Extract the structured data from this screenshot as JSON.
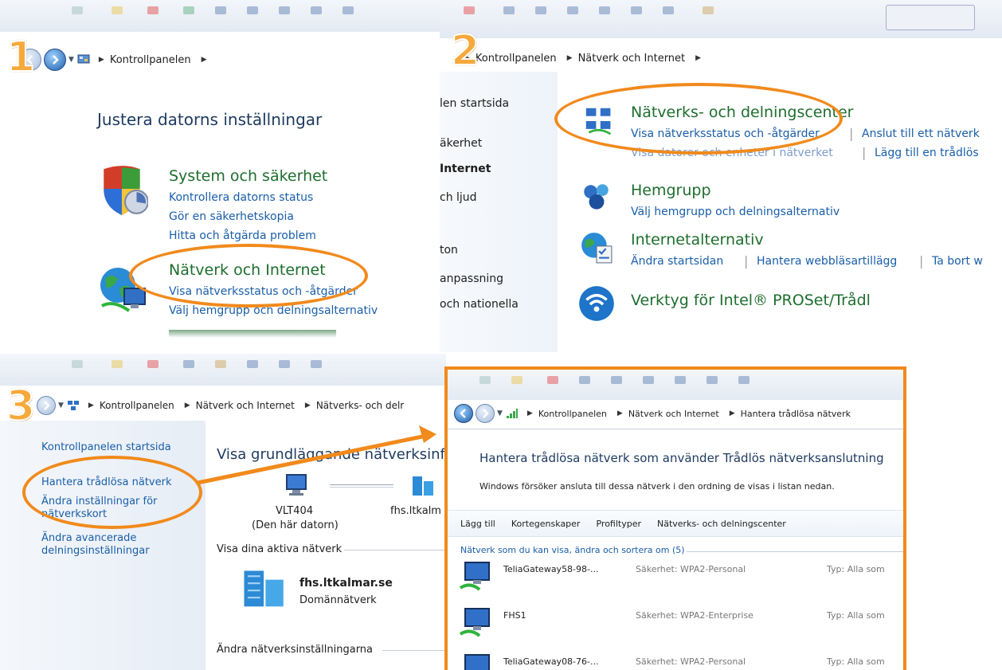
{
  "steps": [
    "1",
    "2",
    "3"
  ],
  "panel1": {
    "breadcrumb": [
      "Kontrollpanelen"
    ],
    "heading": "Justera datorns inställningar",
    "categories": [
      {
        "title": "System och säkerhet",
        "links": [
          "Kontrollera datorns status",
          "Gör en säkerhetskopia",
          "Hitta och åtgärda problem"
        ],
        "icon": "shield-icon"
      },
      {
        "title": "Nätverk och Internet",
        "links": [
          "Visa nätverksstatus och -åtgärder",
          "Välj hemgrupp och delningsalternativ"
        ],
        "icon": "globe-network-icon"
      }
    ]
  },
  "panel2": {
    "breadcrumb": [
      "Kontrollpanelen",
      "Nätverk och Internet"
    ],
    "sidebar": [
      "len startsida",
      "äkerhet",
      "Internet",
      "ch ljud",
      "ton",
      "anpassning",
      "och nationella"
    ],
    "categories": [
      {
        "title": "Nätverks- och delningscenter",
        "links": [
          "Visa nätverksstatus och -åtgärder",
          "Anslut till ett nätverk"
        ],
        "links2": [
          "Visa datorer och enheter i nätverket",
          "Lägg till en trådlös"
        ],
        "icon": "network-center-icon"
      },
      {
        "title": "Hemgrupp",
        "links": [
          "Välj hemgrupp och delningsalternativ"
        ],
        "icon": "homegroup-icon"
      },
      {
        "title": "Internetalternativ",
        "links": [
          "Ändra startsidan",
          "Hantera webbläsartillägg",
          "Ta bort w"
        ],
        "icon": "internet-options-icon"
      },
      {
        "title": "Verktyg för Intel® PROSet/Trådl",
        "links": [],
        "icon": "wifi-icon"
      }
    ]
  },
  "panel3": {
    "breadcrumb": [
      "Kontrollpanelen",
      "Nätverk och Internet",
      "Nätverks- och delr"
    ],
    "sidebar": {
      "home": "Kontrollpanelen startsida",
      "manage": "Hantera trådlösa nätverk",
      "adapter_line1": "Ändra inställningar för",
      "adapter_line2": "nätverkskort",
      "advanced_line1": "Ändra avancerade",
      "advanced_line2": "delningsinställningar"
    },
    "heading": "Visa grundläggande nätverksinfo",
    "computer_name": "VLT404",
    "computer_sub": "(Den här datorn)",
    "domain_short": "fhs.ltkalm",
    "active_label": "Visa dina aktiva nätverk",
    "network_name": "fhs.ltkalmar.se",
    "network_type": "Domännätverk",
    "change_label": "Ändra nätverksinställningarna"
  },
  "panel4": {
    "breadcrumb": [
      "Kontrollpanelen",
      "Nätverk och Internet",
      "Hantera trådlösa nätverk"
    ],
    "title": "Hantera trådlösa nätverk som använder Trådlös nätverksanslutning",
    "description": "Windows försöker ansluta till dessa nätverk i den ordning de visas i listan nedan.",
    "toolbar": [
      "Lägg till",
      "Kortegenskaper",
      "Profiltyper",
      "Nätverks- och delningscenter"
    ],
    "list_header": "Nätverk som du kan visa, ändra och sortera om (5)",
    "networks": [
      {
        "name": "TeliaGateway58-98-...",
        "security": "Säkerhet: WPA2-Personal",
        "type": "Typ: Alla som"
      },
      {
        "name": "FHS1",
        "security": "Säkerhet: WPA2-Enterprise",
        "type": "Typ: Alla som"
      },
      {
        "name": "TeliaGateway08-76-...",
        "security": "Säkerhet: WPA2-Personal",
        "type": "Typ: Alla som"
      }
    ]
  },
  "colors": {
    "highlight": "#f18a1c",
    "link": "#1a5ea8",
    "category": "#1e6e2e",
    "step_number": "#f6a93b"
  }
}
